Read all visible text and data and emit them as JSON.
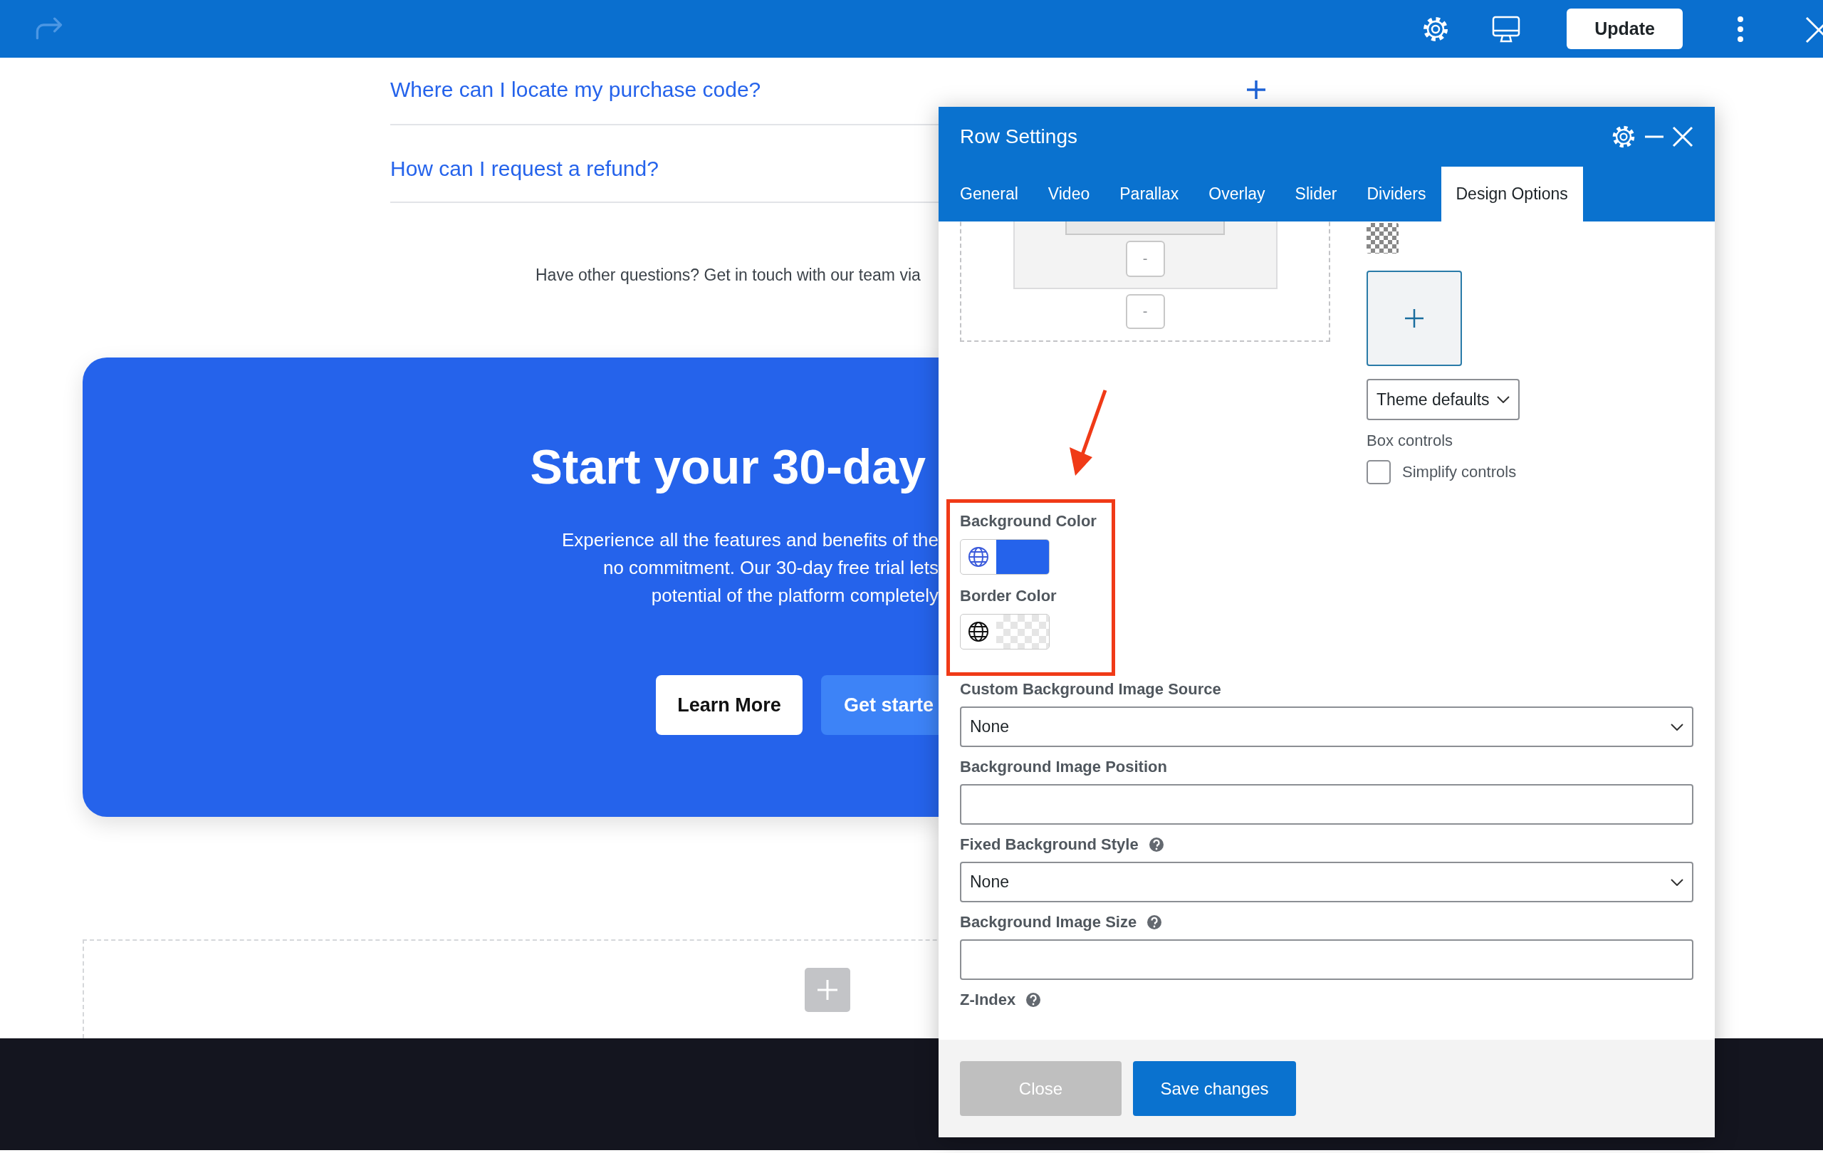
{
  "toolbar": {
    "update_button": "Update"
  },
  "faq": [
    {
      "question": "Where can I locate my purchase code?"
    },
    {
      "question": "How can I request a refund?"
    }
  ],
  "contact_text": "Have other questions? Get in touch with our team via",
  "cta": {
    "heading": "Start your 30-day",
    "body": "Experience all the features and benefits of the\nno commitment. Our 30-day free trial lets\npotential of the platform completely",
    "buttons": [
      {
        "label": "Learn More",
        "kind": "secondary"
      },
      {
        "label": "Get starte",
        "kind": "primary"
      }
    ]
  },
  "dialog": {
    "title": "Row Settings",
    "tabs": [
      {
        "label": "General",
        "selected": false
      },
      {
        "label": "Video",
        "selected": false
      },
      {
        "label": "Parallax",
        "selected": false
      },
      {
        "label": "Overlay",
        "selected": false
      },
      {
        "label": "Slider",
        "selected": false
      },
      {
        "label": "Dividers",
        "selected": false
      },
      {
        "label": "Design Options",
        "selected": true
      }
    ],
    "spacing_buttons": [
      "-",
      "-"
    ],
    "theme_select": "Theme defaults",
    "box_controls_label": "Box controls",
    "simplify": {
      "label": "Simplify controls",
      "checked": false
    },
    "colors": [
      {
        "label": "Background Color",
        "kind": "solid",
        "color": "#2563eb"
      },
      {
        "label": "Border Color",
        "kind": "transparent"
      }
    ],
    "fields": [
      {
        "label": "Custom Background Image Source",
        "kind": "select",
        "value": "None",
        "help": false
      },
      {
        "label": "Background Image Position",
        "kind": "input",
        "help": false
      },
      {
        "label": "Fixed Background Style",
        "kind": "select",
        "value": "None",
        "help": true
      },
      {
        "label": "Background Image Size",
        "kind": "input",
        "help": true
      },
      {
        "label": "Z-Index",
        "kind": "label",
        "help": true
      }
    ],
    "footer_buttons": [
      {
        "label": "Close",
        "kind": "secondary"
      },
      {
        "label": "Save changes",
        "kind": "primary"
      }
    ]
  }
}
